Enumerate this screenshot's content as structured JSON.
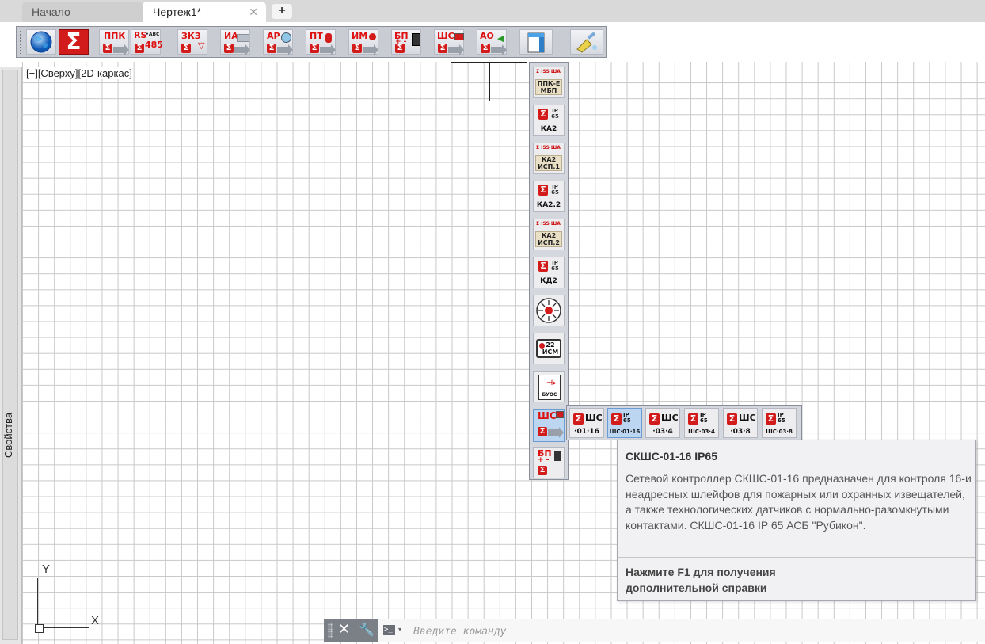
{
  "tabs": [
    {
      "label": "Начало"
    },
    {
      "label": "Чертеж1*",
      "close": "✕"
    }
  ],
  "tab_add": "+",
  "toolbar": {
    "buttons": [
      {
        "icon": "globe-icon"
      },
      {
        "icon": "sigma-logo-icon",
        "text": "Σ"
      },
      {
        "label": "ППК"
      },
      {
        "label": "RS",
        "sup": "•ABC",
        "sub": "485"
      },
      {
        "label": "ЗКЗ"
      },
      {
        "label": "ИА"
      },
      {
        "label": "АР"
      },
      {
        "label": "ПТ"
      },
      {
        "label": "ИМ"
      },
      {
        "label": "БП",
        "sub": "+ -"
      },
      {
        "label": "ШС"
      },
      {
        "label": "АО"
      },
      {
        "icon": "document-icon"
      },
      {
        "icon": "clean-brush-icon"
      }
    ]
  },
  "properties_panel": {
    "label": "Свойства"
  },
  "viewport": {
    "label": "[−][Сверху][2D-каркас]"
  },
  "flyout": {
    "items": [
      {
        "top_text": "Σ ISS  ША",
        "text1": "ППК-Е",
        "text2": "МБП"
      },
      {
        "ip": "IP 65",
        "model": "КА2"
      },
      {
        "top_text": "Σ ISS  ША",
        "text1": "КА2",
        "text2": "ИСП.1"
      },
      {
        "ip": "IP 65",
        "model": "КА2.2"
      },
      {
        "top_text": "Σ ISS  ША",
        "text1": "КА2",
        "text2": "ИСП.2"
      },
      {
        "ip": "IP 65",
        "model": "КД2"
      },
      {
        "icon": "detector-icon"
      },
      {
        "model": "22 ИСМ"
      },
      {
        "model": "БУОС"
      },
      {
        "label": "ШС"
      },
      {
        "label": "БП",
        "sub": "+ -"
      }
    ]
  },
  "sub_flyout": {
    "items": [
      {
        "hdr": "ШС",
        "cap": "·01·16"
      },
      {
        "hdr": "IP 65",
        "cap": "ШС·01·16"
      },
      {
        "hdr": "ШС",
        "cap": "·03·4"
      },
      {
        "hdr": "IP 65",
        "cap": "ШС·03·4"
      },
      {
        "hdr": "ШС",
        "cap": "·03·8"
      },
      {
        "hdr": "IP 65",
        "cap": "ШС·03·8"
      }
    ]
  },
  "tooltip": {
    "title": "СКШС-01-16 IP65",
    "body": "Сетевой контроллер СКШС-01-16 предназначен для контроля 16-и неадресных шлейфов для пожарных или охранных извещателей, а также технологических датчиков с нормально-разомкнутыми контактами. СКШС-01-16 IP 65 АСБ \"Рубикон\".",
    "help": "Нажмите F1 для получения дополнительной справки"
  },
  "ucs": {
    "x": "X",
    "y": "Y"
  },
  "command_line": {
    "close": "✕",
    "wrench": "🔧",
    "prompt": ">_",
    "caret": "▾",
    "placeholder": "Введите команду"
  },
  "colors": {
    "accent_red": "#d21b1b",
    "selection_blue": "#bcd6f2",
    "toolbar_bg": "#c9ccd3",
    "tab_bar_bg": "#d9d9d9"
  }
}
